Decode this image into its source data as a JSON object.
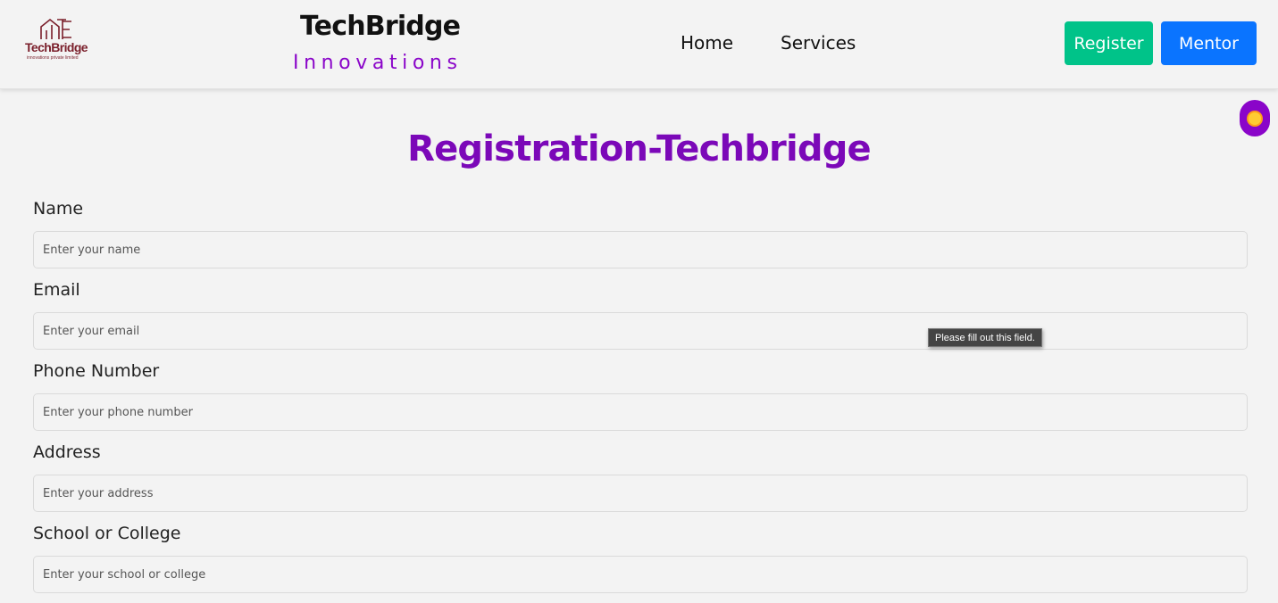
{
  "header": {
    "logo": {
      "text": "TechBridge",
      "subtext": "innovations private limited"
    },
    "brand_title": "TechBridge",
    "brand_subtitle": "Innovations",
    "nav": [
      {
        "label": "Home"
      },
      {
        "label": "Services"
      }
    ],
    "register_label": "Register",
    "mentor_label": "Mentor"
  },
  "theme_toggle": {
    "icon": "sun-icon"
  },
  "page_title": "Registration-Techbridge",
  "form": {
    "fields": [
      {
        "label": "Name",
        "placeholder": "Enter your name",
        "value": ""
      },
      {
        "label": "Email",
        "placeholder": "Enter your email",
        "value": ""
      },
      {
        "label": "Phone Number",
        "placeholder": "Enter your phone number",
        "value": ""
      },
      {
        "label": "Address",
        "placeholder": "Enter your address",
        "value": ""
      },
      {
        "label": "School or College",
        "placeholder": "Enter your school or college",
        "value": ""
      }
    ],
    "validation_tooltip": "Please fill out this field."
  },
  "colors": {
    "accent_purple": "#7b08b8",
    "register_green": "#00c389",
    "mentor_blue": "#0a74ff",
    "logo_maroon": "#7a1f2b"
  }
}
